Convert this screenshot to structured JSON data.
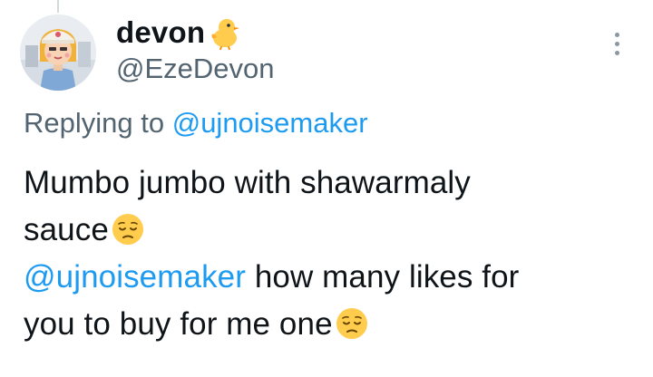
{
  "author": {
    "display_name": "devon",
    "name_emoji": "baby-chick-emoji",
    "handle": "@EzeDevon",
    "avatar": "avatar-cartoon-character"
  },
  "reply_context": {
    "prefix": "Replying to",
    "mention": "@ujnoisemaker"
  },
  "tweet": {
    "line1": "Mumbo jumbo with shawarmaly",
    "line2_text": "sauce",
    "line2_emoji": "pensive-face-emoji",
    "mention": "@ujnoisemaker",
    "line3_rest": "how many likes for",
    "line4_text": "you to buy for me one",
    "line4_emoji": "pensive-face-emoji"
  },
  "icons": {
    "more": "more-vertical-icon"
  },
  "colors": {
    "text": "#0f1419",
    "secondary": "#536471",
    "link": "#1d9bf0",
    "thread_line": "#cfd9de",
    "emoji_yellow": "#ffcc4d"
  }
}
